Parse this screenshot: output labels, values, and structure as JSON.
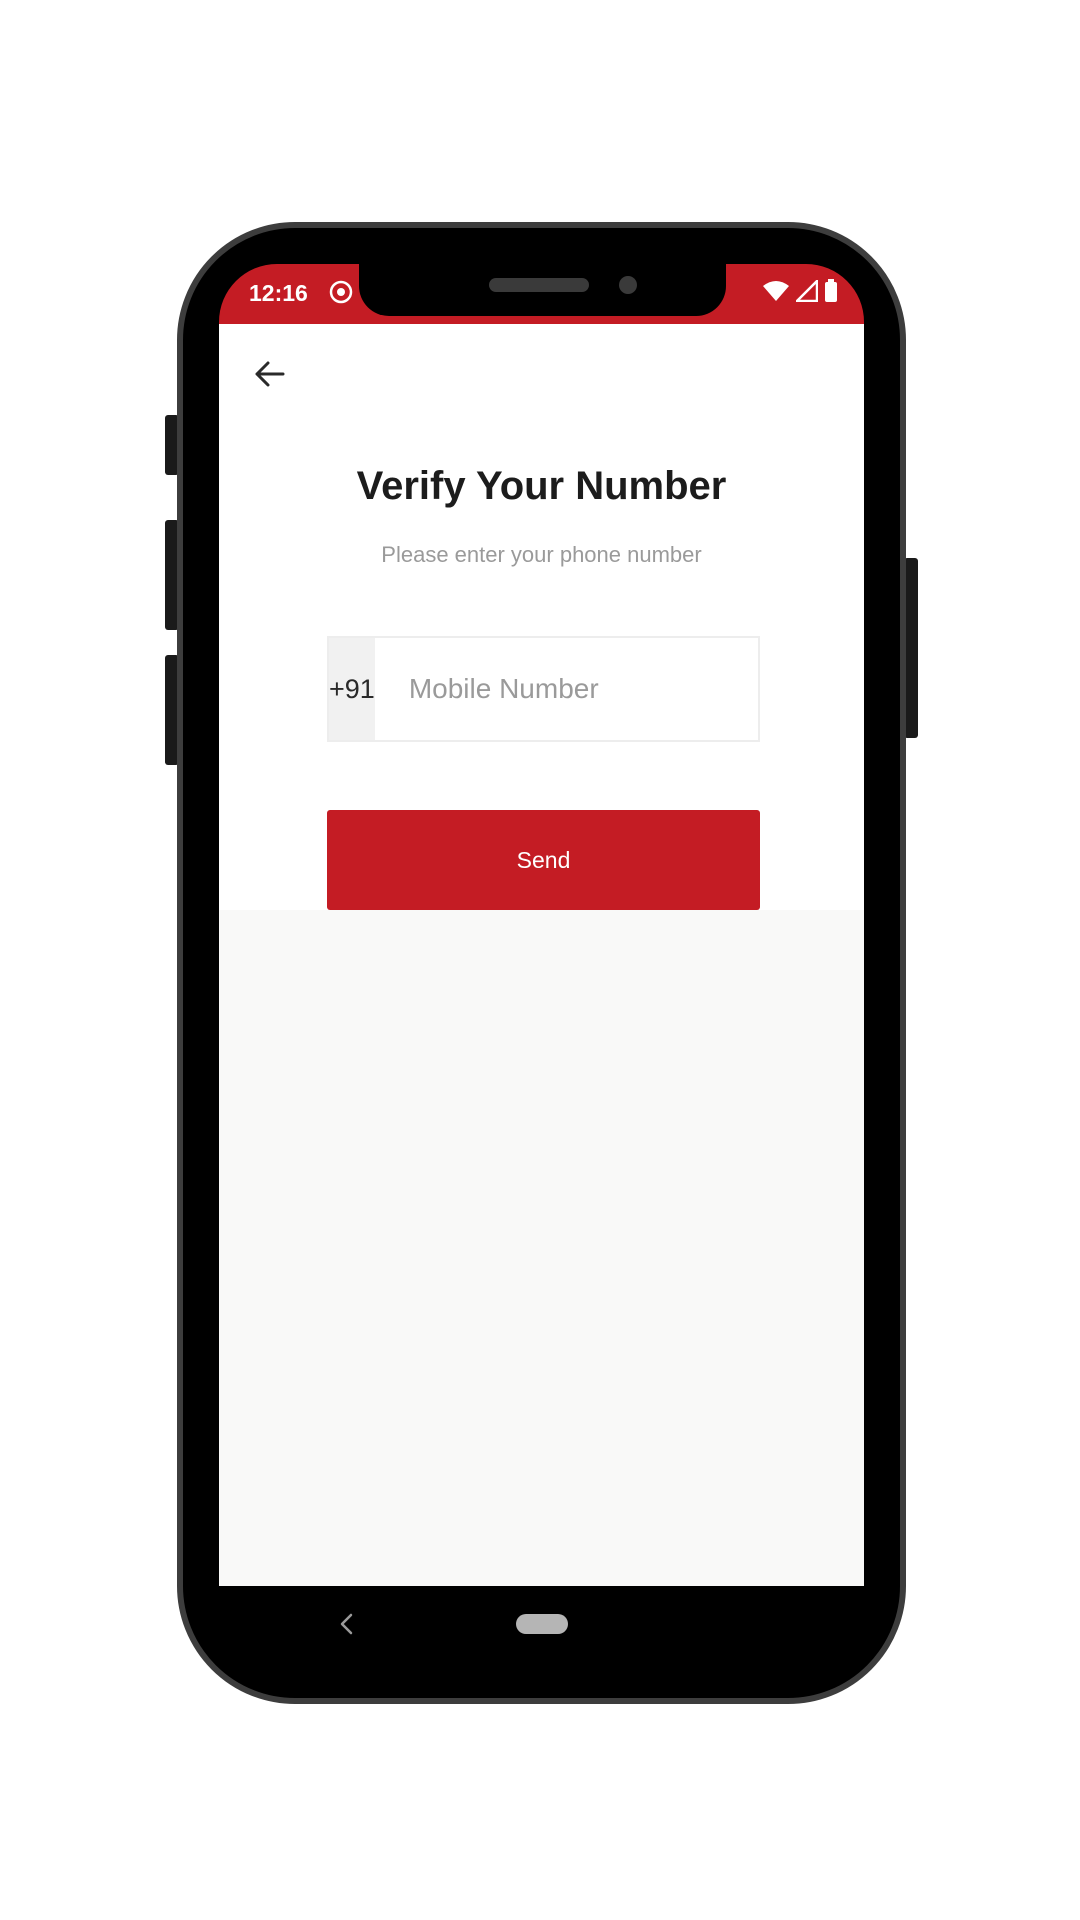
{
  "status_bar": {
    "time": "12:16",
    "background_color": "#c41c24",
    "icons": [
      "app-notification-icon",
      "wifi-icon",
      "signal-icon",
      "battery-icon"
    ]
  },
  "header": {
    "back_icon": "arrow-left-icon"
  },
  "main": {
    "title": "Verify Your Number",
    "subtitle": "Please enter your phone number",
    "country_code": "+91",
    "phone_input": {
      "value": "",
      "placeholder": "Mobile Number"
    },
    "send_label": "Send",
    "accent_color": "#c41c24"
  },
  "nav_bar": {
    "back_icon": "nav-back-icon",
    "home_icon": "nav-home-pill-icon"
  }
}
